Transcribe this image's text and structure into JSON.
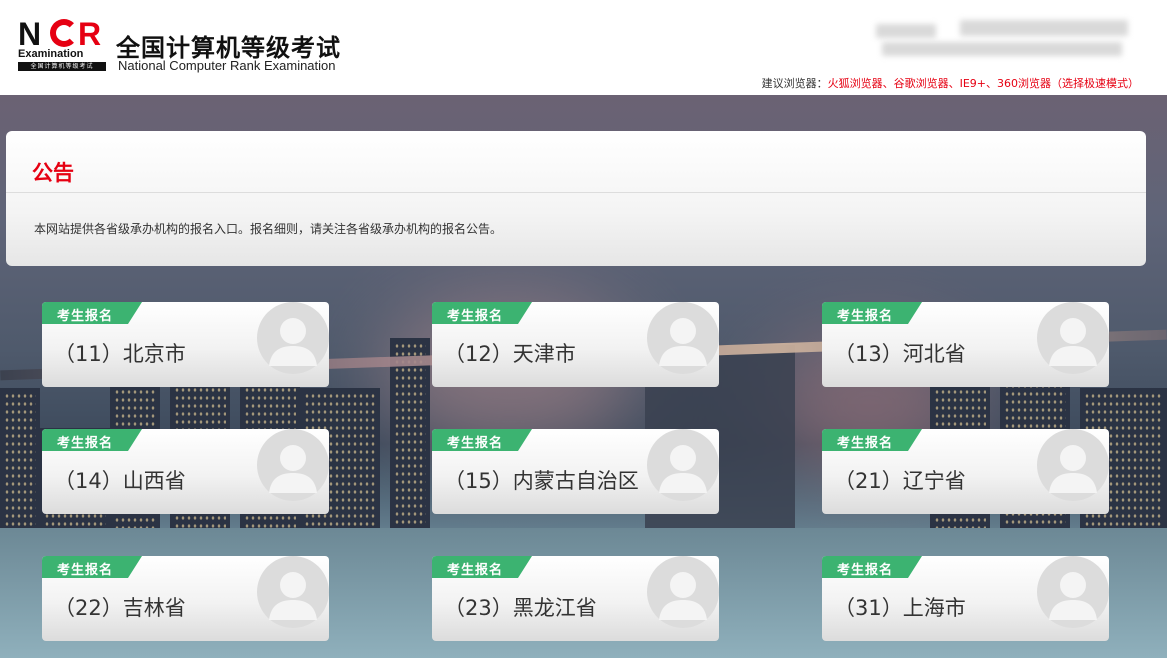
{
  "header": {
    "logo_big": "NCR",
    "logo_exam": "Examination",
    "logo_bar": "全国计算机等级考试",
    "title_cn": "全国计算机等级考试",
    "title_en": "National Computer Rank Examination",
    "browser_hint_label": "建议浏览器：",
    "browser_hint_value": "火狐浏览器、谷歌浏览器、IE9+、360浏览器（选择极速模式）"
  },
  "notice": {
    "title": "公告",
    "text": "本网站提供各省级承办机构的报名入口。报名细则，请关注各省级承办机构的报名公告。"
  },
  "badge_label": "考生报名",
  "colors": {
    "accent_red": "#e60012",
    "badge_green": "#3cb371"
  },
  "cards": [
    {
      "label": "（11）北京市"
    },
    {
      "label": "（12）天津市"
    },
    {
      "label": "（13）河北省"
    },
    {
      "label": "（14）山西省"
    },
    {
      "label": "（15）内蒙古自治区"
    },
    {
      "label": "（21）辽宁省"
    },
    {
      "label": "（22）吉林省"
    },
    {
      "label": "（23）黑龙江省"
    },
    {
      "label": "（31）上海市"
    }
  ]
}
